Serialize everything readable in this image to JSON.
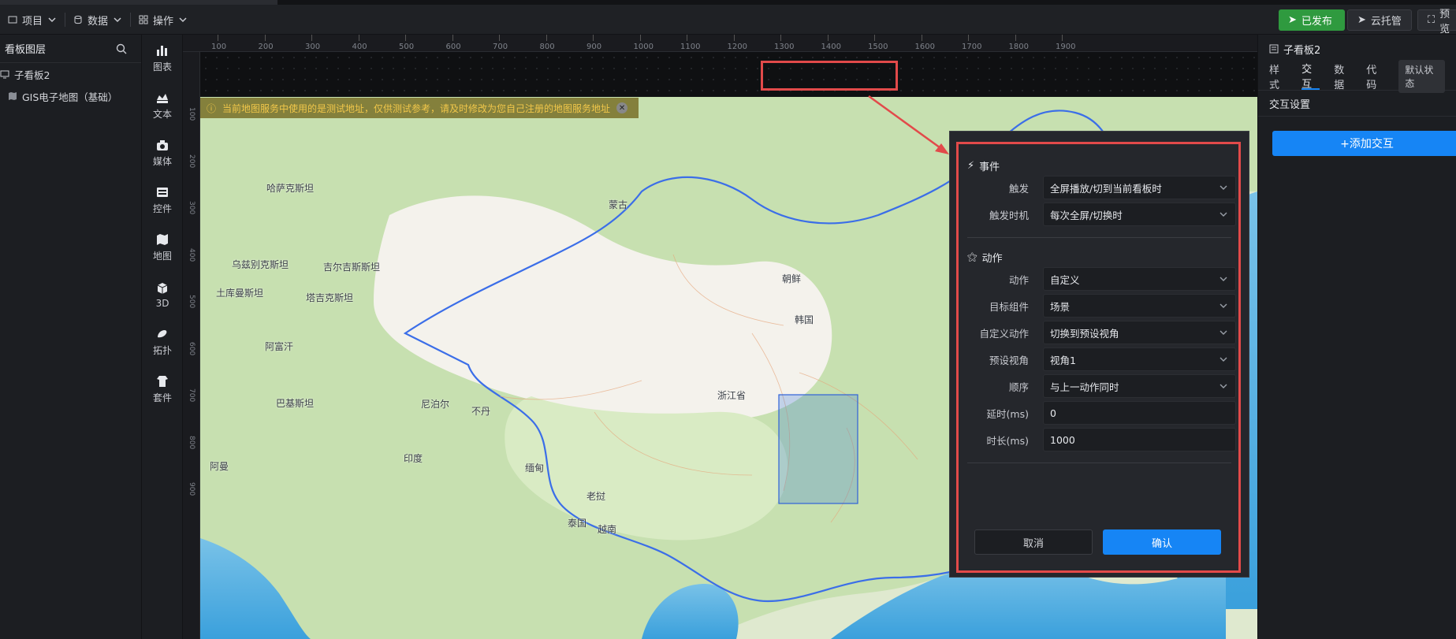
{
  "topbar": {
    "menus": [
      {
        "label": "项目",
        "icon": "project-icon"
      },
      {
        "label": "数据",
        "icon": "database-icon"
      },
      {
        "label": "操作",
        "icon": "grid-icon"
      }
    ],
    "published_label": "已发布",
    "cloud_label": "云托管",
    "preview_label": "预览"
  },
  "left_panel": {
    "title": "看板图层",
    "items": [
      {
        "label": "子看板2"
      },
      {
        "label": "GIS电子地图（基础）"
      }
    ]
  },
  "icon_bar": [
    {
      "label": "图表",
      "icon": "chart-icon"
    },
    {
      "label": "文本",
      "icon": "text-icon"
    },
    {
      "label": "媒体",
      "icon": "media-icon"
    },
    {
      "label": "控件",
      "icon": "control-icon"
    },
    {
      "label": "地图",
      "icon": "map-icon"
    },
    {
      "label": "3D",
      "icon": "cube-icon"
    },
    {
      "label": "拓扑",
      "icon": "topology-icon"
    },
    {
      "label": "套件",
      "icon": "kit-icon"
    }
  ],
  "ruler": {
    "h_ticks": [
      "100",
      "200",
      "300",
      "400",
      "500",
      "600",
      "700",
      "800",
      "900",
      "1000",
      "1100",
      "1200",
      "1300",
      "1400",
      "1500",
      "1600",
      "1700",
      "1800",
      "1900"
    ],
    "v_ticks": [
      "100",
      "200",
      "300",
      "400",
      "500",
      "600",
      "700",
      "800",
      "900"
    ]
  },
  "map": {
    "warning": "当前地图服务中使用的是测试地址，仅供测试参考，请及时修改为您自己注册的地图服务地址",
    "labels": [
      "哈萨克斯坦",
      "乌兹别克斯坦",
      "吉尔吉斯斯坦",
      "塔吉克斯坦",
      "土库曼斯坦",
      "阿富汗",
      "巴基斯坦",
      "阿曼",
      "印度",
      "尼泊尔",
      "不丹",
      "缅甸",
      "泰国",
      "越南",
      "老挝",
      "蒙古",
      "朝鲜",
      "韩国",
      "浙江省"
    ]
  },
  "right_panel": {
    "title": "子看板2",
    "tabs": [
      "样式",
      "交互",
      "数据",
      "代码"
    ],
    "default_state": "默认状态",
    "section": "交互设置",
    "add_button": "+添加交互"
  },
  "dialog": {
    "event_section": "事件",
    "action_section": "动作",
    "fields": [
      {
        "label": "触发",
        "value": "全屏播放/切到当前看板时",
        "type": "select"
      },
      {
        "label": "触发时机",
        "value": "每次全屏/切换时",
        "type": "select"
      },
      {
        "label": "动作",
        "value": "自定义",
        "type": "select"
      },
      {
        "label": "目标组件",
        "value": "场景",
        "type": "select"
      },
      {
        "label": "自定义动作",
        "value": "切换到预设视角",
        "type": "select"
      },
      {
        "label": "预设视角",
        "value": "视角1",
        "type": "select"
      },
      {
        "label": "顺序",
        "value": "与上一动作同时",
        "type": "select"
      },
      {
        "label": "延时(ms)",
        "value": "0",
        "type": "input"
      },
      {
        "label": "时长(ms)",
        "value": "1000",
        "type": "input"
      }
    ],
    "cancel_label": "取消",
    "ok_label": "确认"
  },
  "colors": {
    "accent": "#1685f5",
    "published": "#2f9a3f",
    "highlight": "#e24a4a",
    "china_border": "#3b6ee8"
  }
}
